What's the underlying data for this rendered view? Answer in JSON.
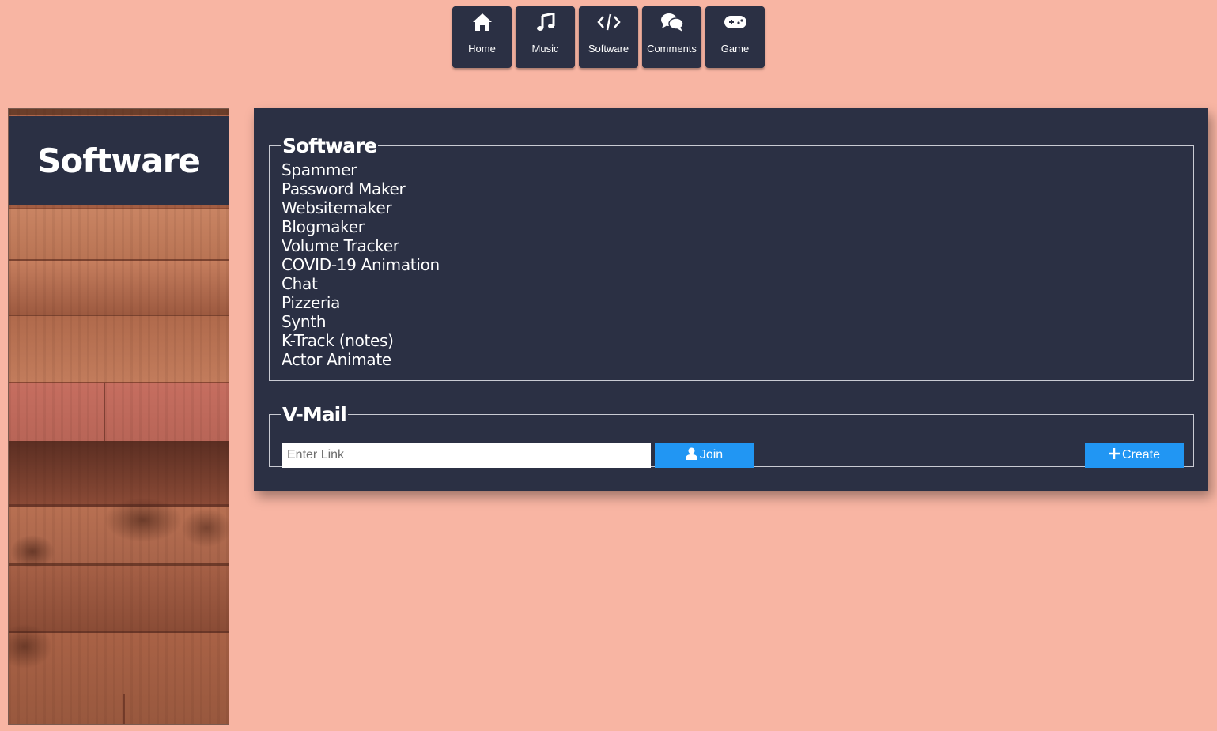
{
  "nav": {
    "items": [
      {
        "label": "Home",
        "icon": "home-icon"
      },
      {
        "label": "Music",
        "icon": "music-note-icon"
      },
      {
        "label": "Software",
        "icon": "code-icon"
      },
      {
        "label": "Comments",
        "icon": "comments-icon"
      },
      {
        "label": "Game",
        "icon": "gamepad-icon"
      }
    ]
  },
  "sidebar": {
    "title": "Software"
  },
  "software": {
    "legend": "Software",
    "items": [
      "Spammer",
      "Password Maker",
      "Websitemaker",
      "Blogmaker",
      "Volume Tracker",
      "COVID-19 Animation",
      "Chat",
      "Pizzeria",
      "Synth",
      "K-Track (notes)",
      "Actor Animate"
    ]
  },
  "vmail": {
    "legend": "V-Mail",
    "link_placeholder": "Enter Link",
    "link_value": "",
    "join_label": "Join",
    "join_icon": "user-icon",
    "create_label": "Create",
    "create_icon": "plus-icon"
  },
  "colors": {
    "background": "#f8b5a3",
    "panel": "#2b3044",
    "accent": "#2196f3"
  }
}
